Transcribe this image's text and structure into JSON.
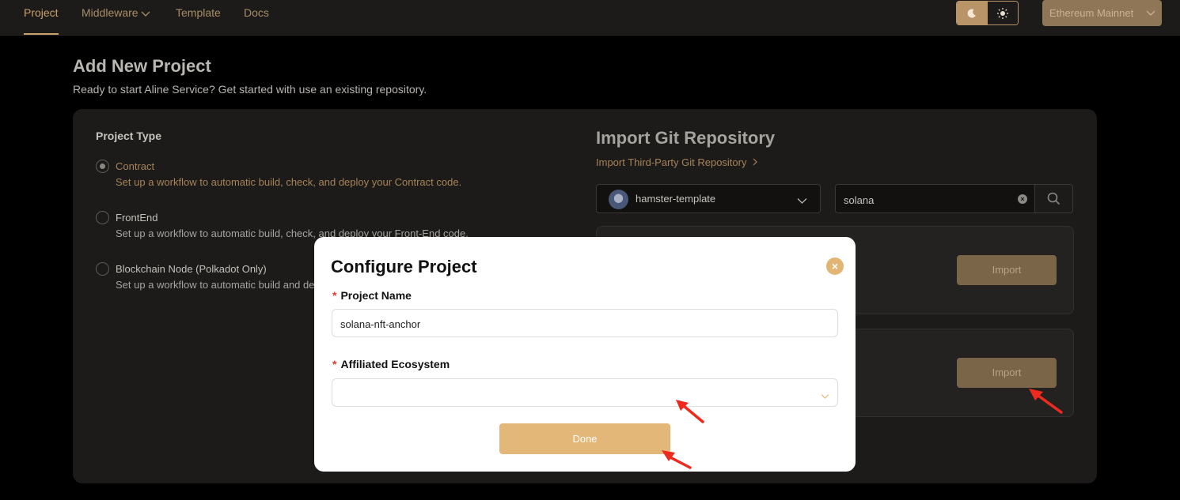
{
  "nav": {
    "items": [
      {
        "label": "Project",
        "active": true
      },
      {
        "label": "Middleware",
        "has_dropdown": true
      },
      {
        "label": "Template"
      },
      {
        "label": "Docs"
      }
    ],
    "theme_toggle": {
      "moon_icon": "moon-icon",
      "sun_icon": "sun-icon",
      "selected": "dark"
    },
    "network": {
      "label": "Ethereum Mainnet",
      "icon": "chevron-down-icon"
    }
  },
  "page": {
    "title": "Add New Project",
    "subtitle": "Ready to start Aline Service? Get started with use an existing repository."
  },
  "project_type": {
    "label": "Project Type",
    "options": [
      {
        "title": "Contract",
        "description": "Set up a workflow to automatic build, check, and deploy your Contract code.",
        "selected": true
      },
      {
        "title": "FrontEnd",
        "description": "Set up a workflow to automatic build, check, and deploy your Front-End code.",
        "selected": false
      },
      {
        "title": "Blockchain Node (Polkadot Only)",
        "description": "Set up a workflow to automatic build and dep",
        "selected": false
      }
    ]
  },
  "import_repo": {
    "title": "Import Git Repository",
    "third_party_link": "Import Third-Party Git Repository",
    "account": "hamster-template",
    "search_value": "solana",
    "search_icon": "search-icon",
    "clear_icon": "clear-icon",
    "import_label": "Import"
  },
  "modal": {
    "title": "Configure Project",
    "close_icon": "close-icon",
    "required_mark": "*",
    "project_name_label": "Project Name",
    "project_name_value": "solana-nft-anchor",
    "ecosystem_label": "Affiliated Ecosystem",
    "ecosystem_value": "",
    "done_label": "Done"
  },
  "colors": {
    "accent": "#c8a06b",
    "button_gold": "#e2b778",
    "import_button": "#7a6549",
    "annotation_arrow": "#ee2a1f"
  }
}
